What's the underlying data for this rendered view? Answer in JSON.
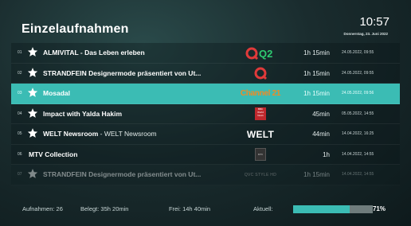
{
  "header": {
    "title": "Einzelaufnahmen",
    "time": "10:57",
    "date": "Donnerstag, 23. Juni 2022"
  },
  "recordings": [
    {
      "num": "01",
      "title": "ALMIVITAL - Das Leben erleben",
      "subtitle": "",
      "channel_logo": "Q2",
      "duration": "1h 15min",
      "date": "24.05.2022, 09:55"
    },
    {
      "num": "02",
      "title": "STRANDFEIN Designermode präsentiert von Ut...",
      "subtitle": "",
      "channel_logo": "Q",
      "duration": "1h 15min",
      "date": "24.05.2022, 09:55"
    },
    {
      "num": "03",
      "title": "Mosadal",
      "subtitle": "",
      "channel_logo": "Channel 21",
      "duration": "1h 15min",
      "date": "24.05.2022, 09:56"
    },
    {
      "num": "04",
      "title": "Impact with Yalda Hakim",
      "subtitle": "",
      "channel_logo": "BBC World News",
      "duration": "45min",
      "date": "05.05.2022, 14:55"
    },
    {
      "num": "05",
      "title": "WELT Newsroom",
      "subtitle": " - WELT Newsroom",
      "channel_logo": "WELT",
      "duration": "44min",
      "date": "14.04.2022, 16:25"
    },
    {
      "num": "06",
      "title": "MTV Collection",
      "subtitle": "",
      "channel_logo": "MTV",
      "duration": "1h",
      "date": "14.04.2022, 14:55"
    },
    {
      "num": "07",
      "title": "STRANDFEIN Designermode präsentiert von Ut...",
      "subtitle": "",
      "channel_logo": "QVC STYLE HD",
      "duration": "1h 15min",
      "date": "14.04.2022, 14:55"
    }
  ],
  "footer": {
    "recordings": "Aufnahmen: 26",
    "used": "Belegt: 35h 20min",
    "free": "Frei: 14h 40min",
    "current_label": "Aktuell:",
    "percent_text": "71%",
    "usage_fraction": 0.71
  },
  "colors": {
    "accent": "#3bbcb4",
    "q2_green": "#2ecc71",
    "qvc_red": "#e03a3a",
    "channel21_orange": "#f08a24",
    "bbc_red": "#c0282d"
  }
}
